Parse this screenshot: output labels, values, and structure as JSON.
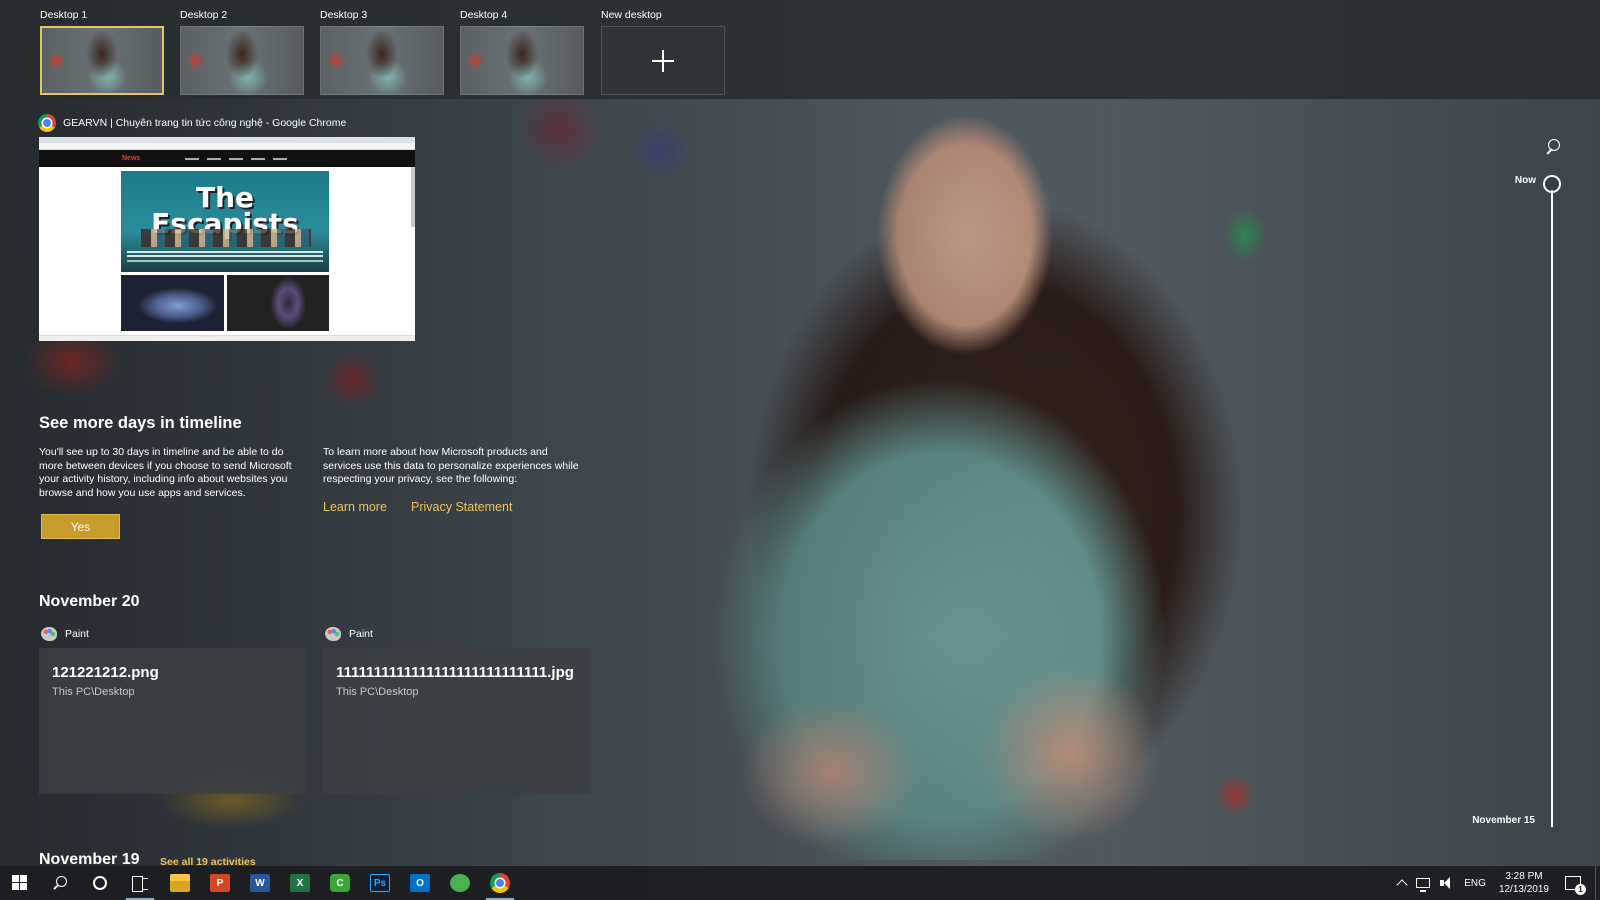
{
  "desktops": [
    {
      "label": "Desktop 1",
      "active": true
    },
    {
      "label": "Desktop 2",
      "active": false
    },
    {
      "label": "Desktop 3",
      "active": false
    },
    {
      "label": "Desktop 4",
      "active": false
    }
  ],
  "new_desktop_label": "New desktop",
  "window": {
    "title": "GEARVN | Chuyên trang tin tức công nghệ - Google Chrome",
    "preview": {
      "site_logo": "News",
      "hero_title": "The Escapists"
    }
  },
  "promo": {
    "title": "See more days in timeline",
    "text_left": "You'll see up to 30 days in timeline and be able to do more between devices if you choose to send Microsoft your activity history, including info about websites you browse and how you use apps and services.",
    "text_right": "To learn more about how Microsoft products and services use this data to personalize experiences while respecting your privacy, see the following:",
    "yes_label": "Yes",
    "learn_more_label": "Learn more",
    "privacy_label": "Privacy Statement"
  },
  "sections": [
    {
      "date": "November 20",
      "activities": [
        {
          "app": "Paint",
          "title": "121221212.png",
          "location": "This PC\\Desktop"
        },
        {
          "app": "Paint",
          "title": "1111111111111111111111111111.jpg",
          "location": "This PC\\Desktop"
        }
      ]
    },
    {
      "date": "November 19",
      "see_all_label": "See all 19 activities"
    }
  ],
  "timeline": {
    "now_label": "Now",
    "bottom_label": "November 15"
  },
  "taskbar": {
    "apps": [
      "start-icon",
      "search-icon",
      "cortana-icon",
      "task-view-icon",
      "file-explorer-icon",
      "powerpoint-icon",
      "word-icon",
      "excel-icon",
      "camtasia-icon",
      "photoshop-icon",
      "outlook-icon",
      "green-app-icon",
      "chrome-icon"
    ],
    "ppt_letter": "P",
    "word_letter": "W",
    "excel_letter": "X",
    "camtasia_letter": "C",
    "ps_letter": "Ps",
    "outlook_letter": "O",
    "language": "ENG",
    "time": "3:28 PM",
    "date": "12/13/2019",
    "notification_count": "1"
  },
  "colors": {
    "accent": "#c99d2d",
    "link": "#f0c35b",
    "active_desktop_border": "#e5c36c"
  }
}
